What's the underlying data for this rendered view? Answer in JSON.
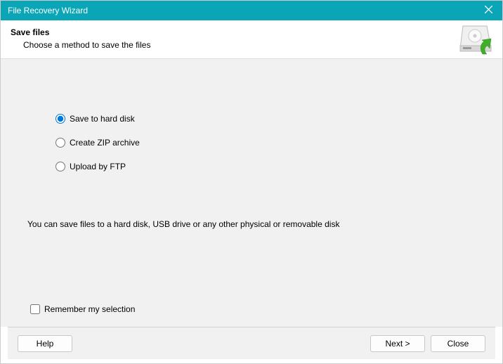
{
  "window": {
    "title": "File Recovery Wizard"
  },
  "header": {
    "title": "Save files",
    "subtitle": "Choose a method to save the files"
  },
  "options": {
    "save_disk": "Save to hard disk",
    "create_zip": "Create ZIP archive",
    "upload_ftp": "Upload by FTP",
    "selected": "save_disk"
  },
  "description": "You can save files to a hard disk, USB drive or any other physical or removable disk",
  "remember_label": "Remember my selection",
  "buttons": {
    "help": "Help",
    "next": "Next >",
    "close": "Close"
  }
}
